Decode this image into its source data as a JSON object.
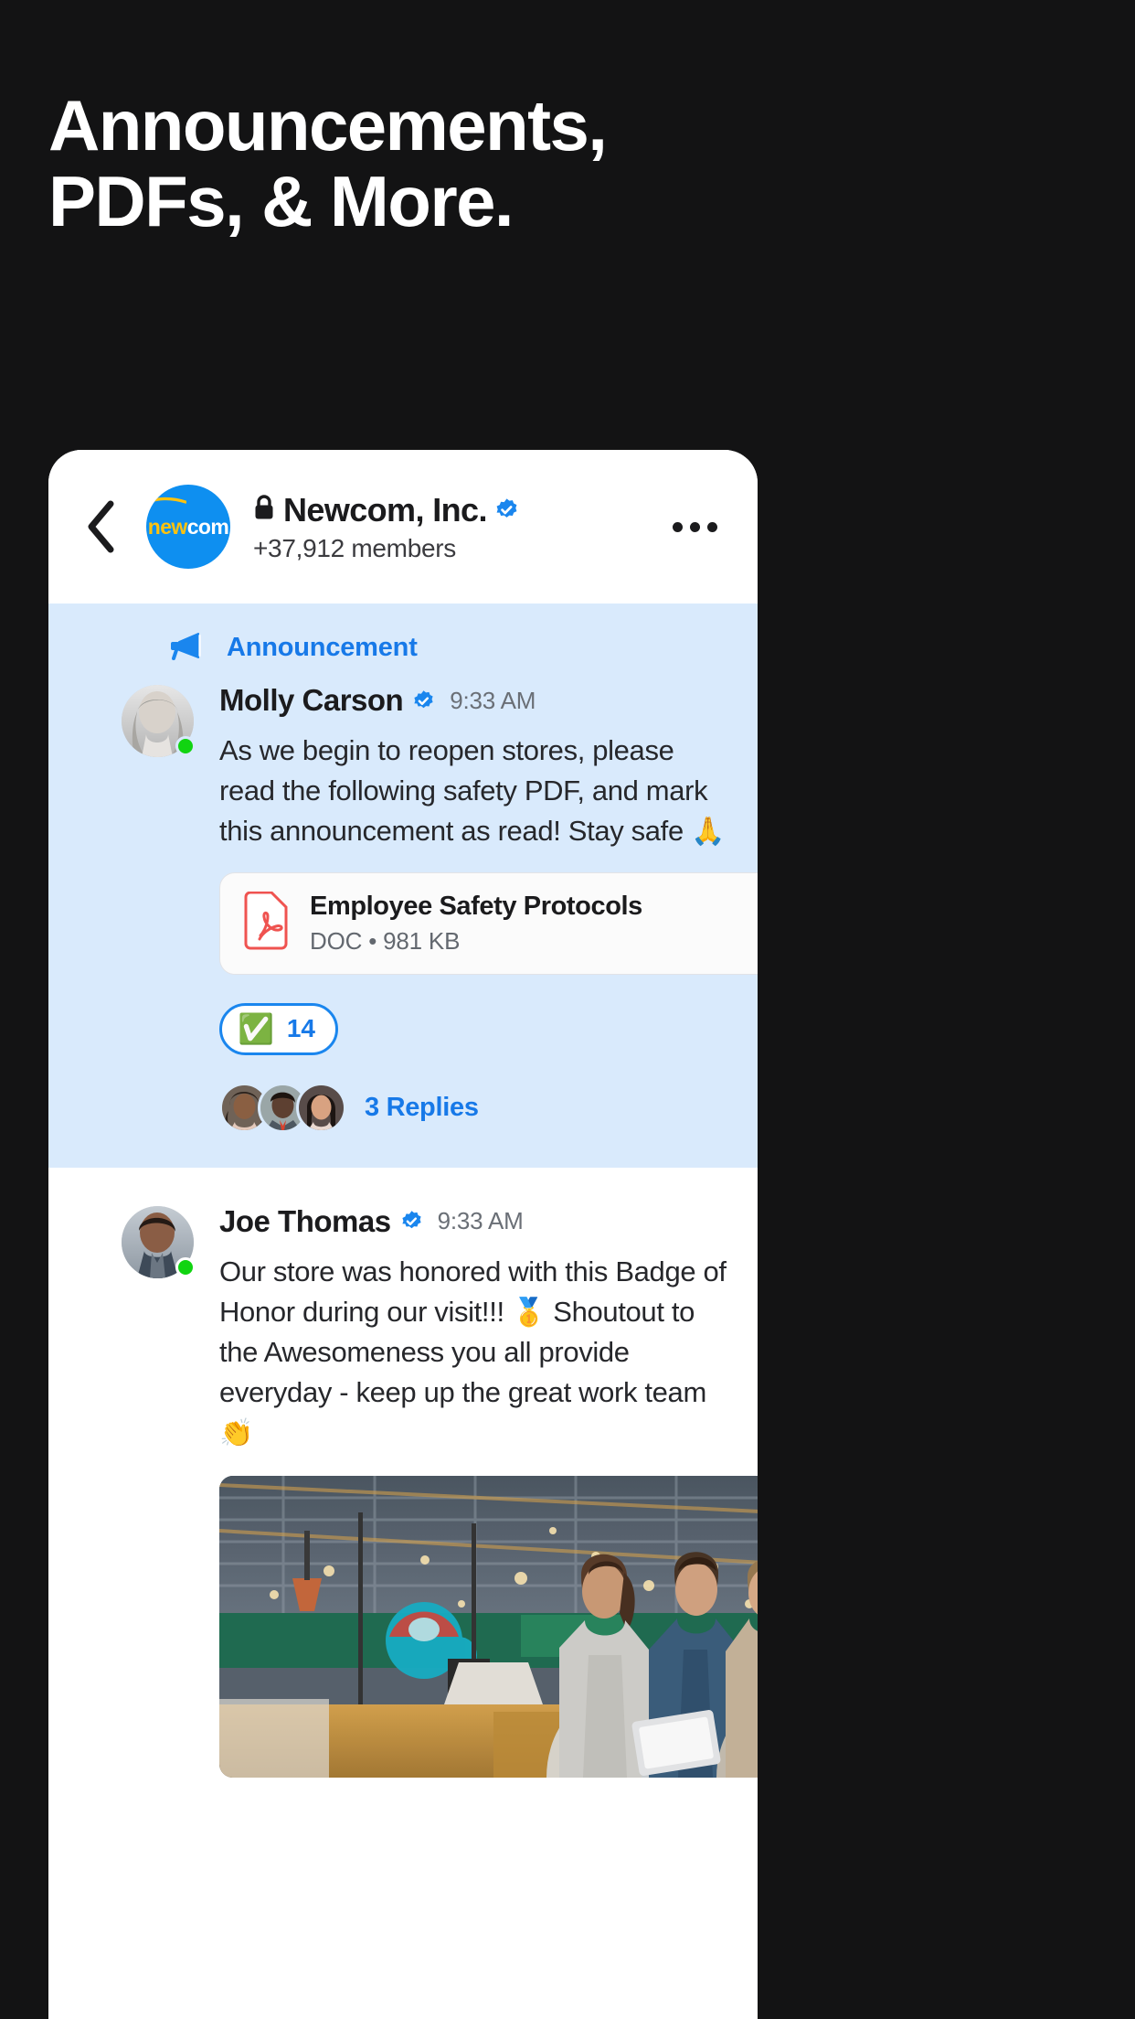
{
  "headline": {
    "line1": "Announcements,",
    "line2": "PDFs, & More."
  },
  "chat_header": {
    "back_label": "Back",
    "logo_text_1": "new",
    "logo_text_2": "com",
    "group_name": "Newcom, Inc.",
    "members": "+37,912 members",
    "more_label": "More options"
  },
  "announcement": {
    "label": "Announcement",
    "author": "Molly Carson",
    "time": "9:33 AM",
    "text": "As we begin to reopen stores, please read the following safety PDF, and mark this announcement as read! Stay safe ",
    "text_emoji": "🙏",
    "attachment": {
      "title": "Employee Safety Protocols",
      "meta": "DOC • 981 KB"
    },
    "reaction": {
      "emoji": "✅",
      "count": "14"
    },
    "replies_label": "3 Replies"
  },
  "message2": {
    "author": "Joe Thomas",
    "time": "9:33 AM",
    "text_a": "Our store was honored with this Badge of Honor during our visit!!! ",
    "emoji_a": "🥇",
    "text_b": " Shoutout to the Awesomeness you all provide everyday - keep up the great work team ",
    "emoji_b": "👏"
  },
  "colors": {
    "background": "#131314",
    "card": "#ffffff",
    "announcement_bg": "#d9eafc",
    "accent_blue": "#1779e8",
    "logo_blue": "#0e8ff0",
    "logo_yellow": "#ffc20e",
    "online_green": "#11d411",
    "pdf_red": "#ef5350"
  },
  "icons": {
    "back": "chevron-left-icon",
    "lock": "lock-icon",
    "verified": "verified-badge-icon",
    "more": "more-horizontal-icon",
    "megaphone": "megaphone-icon",
    "pdf": "pdf-file-icon"
  }
}
